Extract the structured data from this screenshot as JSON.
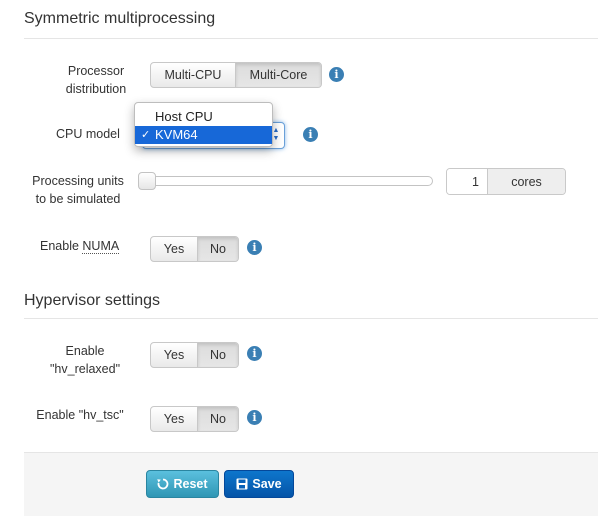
{
  "sections": {
    "smp_title": "Symmetric multiprocessing",
    "hypervisor_title": "Hypervisor settings"
  },
  "processor_distribution": {
    "label_line1": "Processor",
    "label_line2": "distribution",
    "options": [
      "Multi-CPU",
      "Multi-Core"
    ],
    "selected": "Multi-Core"
  },
  "cpu_model": {
    "label": "CPU model",
    "options": [
      "Host CPU",
      "KVM64"
    ],
    "selected": "KVM64",
    "check": "✓"
  },
  "processing_units": {
    "label_line1": "Processing units",
    "label_line2": "to be simulated",
    "value": "1",
    "unit": "cores",
    "slider_fraction": 0.0
  },
  "numa": {
    "label_prefix": "Enable ",
    "label_abbr": "NUMA",
    "yes": "Yes",
    "no": "No",
    "selected": "No"
  },
  "hv_relaxed": {
    "label_line1": "Enable",
    "label_line2": "\"hv_relaxed\"",
    "yes": "Yes",
    "no": "No",
    "selected": "No"
  },
  "hv_tsc": {
    "label": "Enable \"hv_tsc\"",
    "yes": "Yes",
    "no": "No",
    "selected": "No"
  },
  "actions": {
    "reset": "Reset",
    "save": "Save"
  },
  "icons": {
    "info": "info-circle-icon",
    "reset": "undo-icon",
    "save": "floppy-disk-icon"
  },
  "colors": {
    "info": "#3a7fb4",
    "reset": "#49afcd",
    "save": "#0861b8",
    "dropdown_highlight": "#1768d8"
  }
}
